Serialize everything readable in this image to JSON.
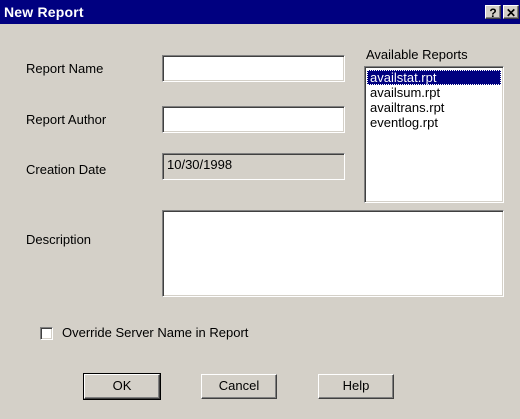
{
  "window": {
    "title": "New Report",
    "help_glyph": "?",
    "close_glyph": "✕"
  },
  "form": {
    "report_name_label": "Report Name",
    "report_name_value": "",
    "report_author_label": "Report Author",
    "report_author_value": "",
    "creation_date_label": "Creation Date",
    "creation_date_value": "10/30/1998",
    "description_label": "Description",
    "description_value": "",
    "override_label": "Override Server Name in Report",
    "override_checked": false
  },
  "available_reports": {
    "label": "Available Reports",
    "items": [
      "availstat.rpt",
      "availsum.rpt",
      "availtrans.rpt",
      "eventlog.rpt"
    ],
    "selected": "availstat.rpt"
  },
  "buttons": {
    "ok": "OK",
    "cancel": "Cancel",
    "help": "Help"
  },
  "icons": [
    "help-icon",
    "close-icon"
  ]
}
